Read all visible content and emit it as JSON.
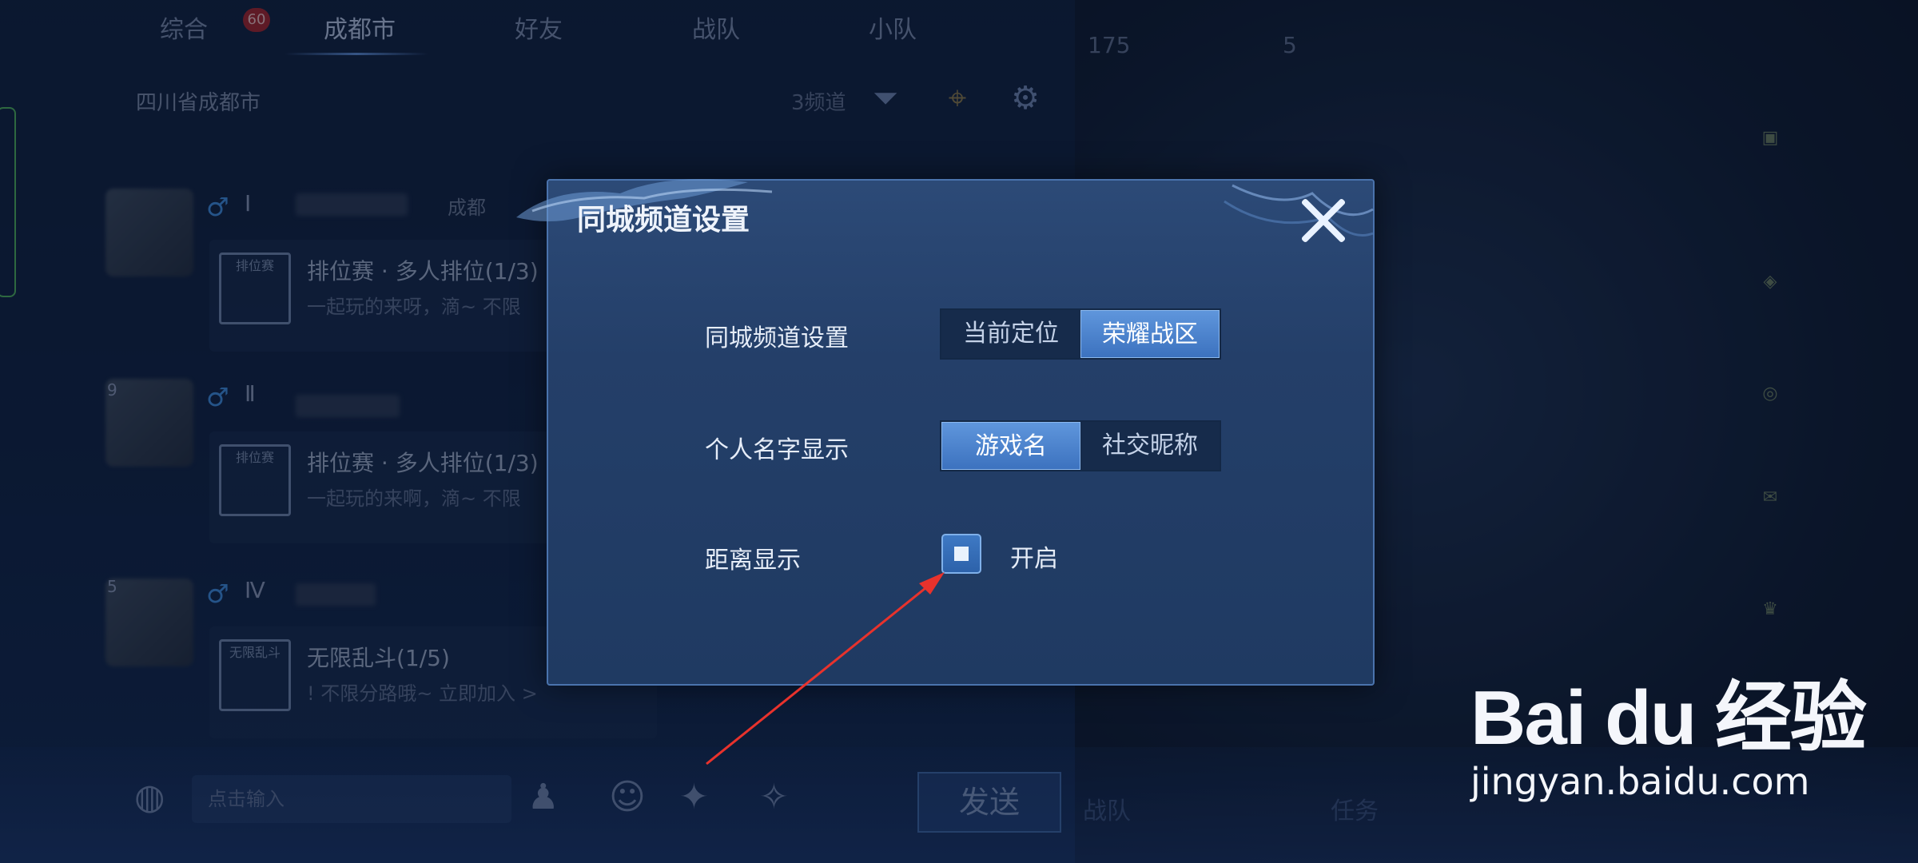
{
  "tabs": [
    {
      "label": "综合"
    },
    {
      "label": "成都市",
      "active": true
    },
    {
      "label": "好友"
    },
    {
      "label": "战队"
    },
    {
      "label": "小队"
    }
  ],
  "tab_badge": "60",
  "location": "四川省成都市",
  "channel_count": "3频道",
  "posts": [
    {
      "mode_icon_text": "排位赛",
      "title": "排位赛 · 多人排位(1/3)",
      "subtitle": "一起玩的来呀，滴~ 不限",
      "rank": "Ⅰ",
      "level": "",
      "city": "成都"
    },
    {
      "mode_icon_text": "排位赛",
      "title": "排位赛 · 多人排位(1/3)",
      "subtitle": "一起玩的来啊，滴~ 不限",
      "rank": "Ⅱ",
      "level": "9"
    },
    {
      "mode_icon_text": "无限乱斗",
      "title": "无限乱斗(1/5)",
      "subtitle": "! 不限分路哦~ 立即加入 >",
      "rank": "Ⅳ",
      "level": "5"
    }
  ],
  "input_placeholder": "点击输入",
  "send_label": "发送",
  "right_stats": [
    "175",
    "5"
  ],
  "right_bottom": [
    "战队",
    "任务"
  ],
  "dialog": {
    "title": "同城频道设置",
    "rows": [
      {
        "label": "同城频道设置",
        "options": [
          "当前定位",
          "荣耀战区"
        ],
        "selected": 1
      },
      {
        "label": "个人名字显示",
        "options": [
          "游戏名",
          "社交昵称"
        ],
        "selected": 0
      }
    ],
    "distance": {
      "label": "距离显示",
      "option_label": "开启",
      "checked": true
    }
  },
  "watermark": {
    "logo": "Bai du 经验",
    "url": "jingyan.baidu.com"
  },
  "colors": {
    "accent": "#4a7fc8",
    "annotation_arrow": "#e8322c"
  }
}
